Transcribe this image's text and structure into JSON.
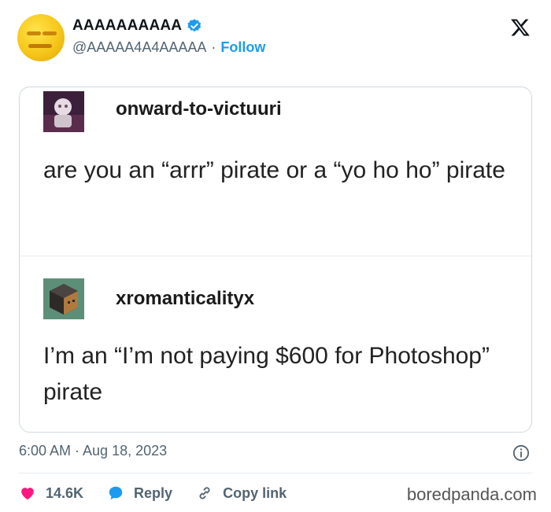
{
  "tweet": {
    "display_name": "AAAAAAAAAA",
    "handle": "@AAAAA4A4AAAAA",
    "separator": "·",
    "follow_label": "Follow",
    "timestamp": "6:00 AM · Aug 18, 2023"
  },
  "embedded_posts": [
    {
      "username": "onward-to-victuuri",
      "text": "are you an “arrr” pirate or a “yo ho ho” pirate"
    },
    {
      "username": "xromanticalityx",
      "text": "I’m an “I’m not paying $600 for Photoshop” pirate"
    }
  ],
  "actions": {
    "likes": "14.6K",
    "reply_label": "Reply",
    "copy_label": "Copy link"
  },
  "watermark": "boredpanda.com",
  "colors": {
    "accent": "#1d9bf0",
    "like": "#f91880",
    "text_secondary": "#536471"
  },
  "icons": {
    "verified": "verified-badge-icon",
    "logo": "x-logo-icon",
    "info": "info-icon",
    "like": "heart-icon",
    "reply": "reply-bubble-icon",
    "copy": "link-icon"
  }
}
